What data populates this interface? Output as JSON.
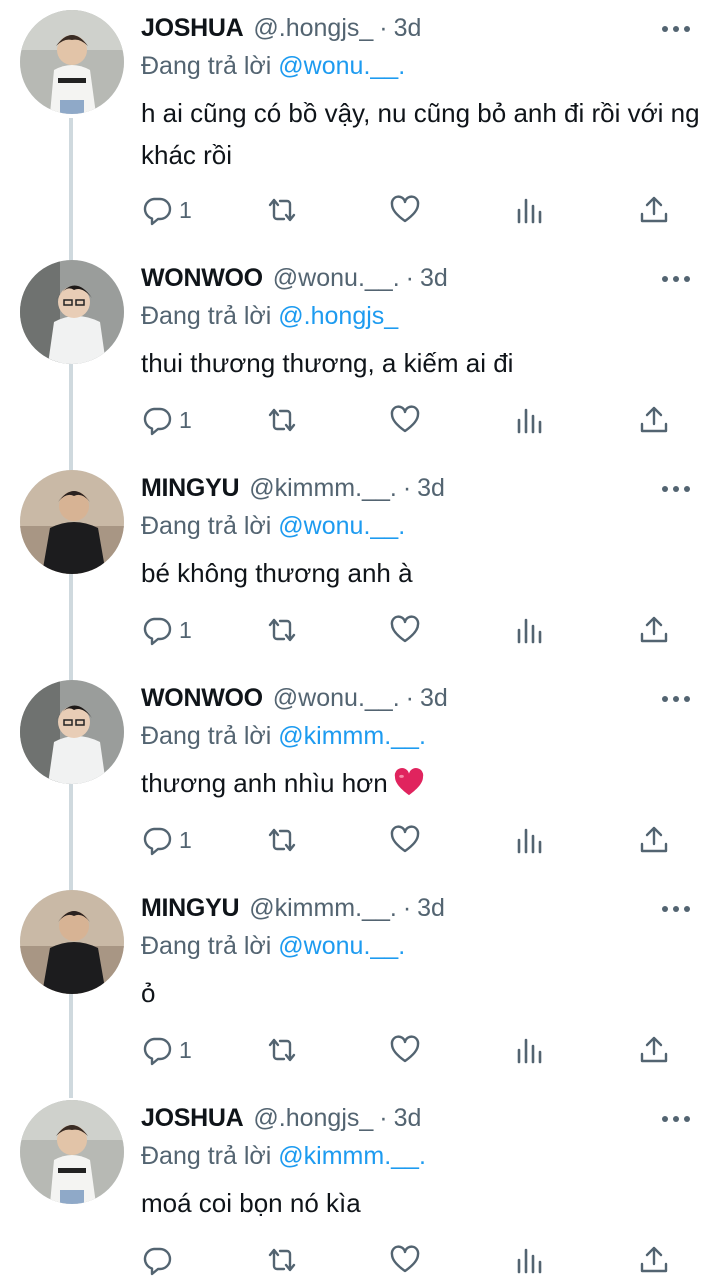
{
  "tweets": [
    {
      "name": "JOSHUA",
      "handle": "@.hongjs_",
      "time": "3d",
      "replying_prefix": "Đang trả lời",
      "replying_to": "@wonu.__.",
      "text": "h ai cũng có bồ vậy, nu cũng bỏ anh đi rồi với ng khác rồi",
      "reply_count": "1",
      "avatar": "joshua"
    },
    {
      "name": "WONWOO",
      "handle": "@wonu.__.",
      "time": "3d",
      "replying_prefix": "Đang trả lời",
      "replying_to": "@.hongjs_",
      "text": "thui thương thương, a kiếm ai đi",
      "reply_count": "1",
      "avatar": "wonwoo"
    },
    {
      "name": "MINGYU",
      "handle": "@kimmm.__.",
      "time": "3d",
      "replying_prefix": "Đang trả lời",
      "replying_to": "@wonu.__.",
      "text": "bé không thương anh à",
      "reply_count": "1",
      "avatar": "mingyu"
    },
    {
      "name": "WONWOO",
      "handle": "@wonu.__.",
      "time": "3d",
      "replying_prefix": "Đang trả lời",
      "replying_to": "@kimmm.__.",
      "text": "thương anh nhìu hơn",
      "emoji": "red-heart-emoji",
      "reply_count": "1",
      "avatar": "wonwoo"
    },
    {
      "name": "MINGYU",
      "handle": "@kimmm.__.",
      "time": "3d",
      "replying_prefix": "Đang trả lời",
      "replying_to": "@wonu.__.",
      "text": "ỏ",
      "reply_count": "1",
      "avatar": "mingyu"
    },
    {
      "name": "JOSHUA",
      "handle": "@.hongjs_",
      "time": "3d",
      "replying_prefix": "Đang trả lời",
      "replying_to": "@kimmm.__.",
      "text": "moá coi bọn nó kìa",
      "reply_count": "",
      "avatar": "joshua"
    }
  ],
  "separator": "·",
  "colors": {
    "text": "#0f1419",
    "secondary": "#536471",
    "mention": "#1d9bf0",
    "thread_line": "#cfd9de",
    "heart": "#e0245e"
  },
  "icons": [
    "reply-icon",
    "retweet-icon",
    "like-icon",
    "views-icon",
    "share-icon",
    "more-icon"
  ]
}
